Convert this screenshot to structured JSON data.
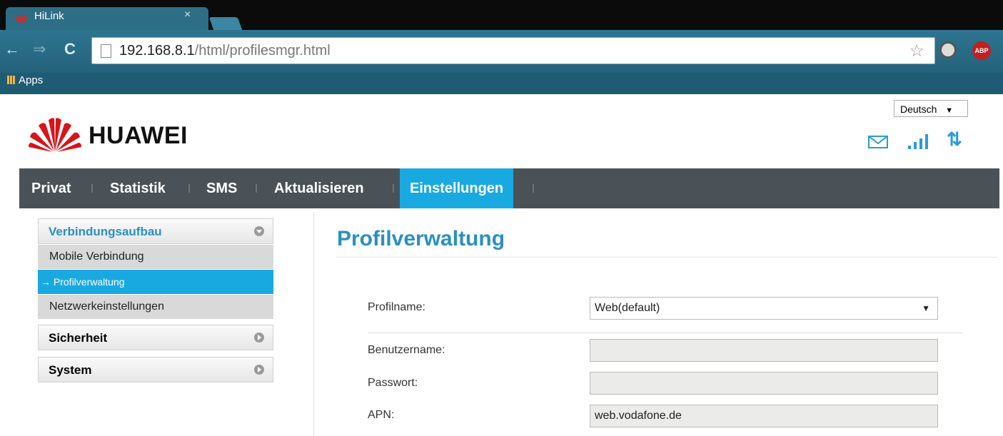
{
  "browser": {
    "tab_title": "HiLink",
    "tab_close": "×",
    "url_host": "192.168.8.1",
    "url_path": "/html/profilesmgr.html",
    "bookmarks_apps": "Apps",
    "ext_abp": "ABP"
  },
  "header": {
    "language": "Deutsch",
    "brand": "HUAWEI"
  },
  "nav": {
    "items": [
      "Privat",
      "Statistik",
      "SMS",
      "Aktualisieren",
      "Einstellungen"
    ],
    "active": "Einstellungen"
  },
  "sidebar": {
    "sections": [
      {
        "label": "Verbindungsaufbau",
        "expanded": true,
        "items": [
          "Mobile Verbindung",
          "→ Profilverwaltung",
          "Netzwerkeinstellungen"
        ],
        "active_item": "→ Profilverwaltung"
      },
      {
        "label": "Sicherheit",
        "expanded": false
      },
      {
        "label": "System",
        "expanded": false
      }
    ]
  },
  "main": {
    "title": "Profilverwaltung",
    "fields": [
      {
        "label": "Profilname:",
        "value": "Web(default)",
        "type": "select"
      },
      {
        "label": "Benutzername:",
        "value": "",
        "type": "text"
      },
      {
        "label": "Passwort:",
        "value": "",
        "type": "password"
      },
      {
        "label": "APN:",
        "value": "web.vodafone.de",
        "type": "text"
      }
    ]
  },
  "colors": {
    "accent": "#19a9e1",
    "navbar": "#4a5257",
    "title": "#2b8fc0",
    "brand_red": "#d7141a"
  }
}
